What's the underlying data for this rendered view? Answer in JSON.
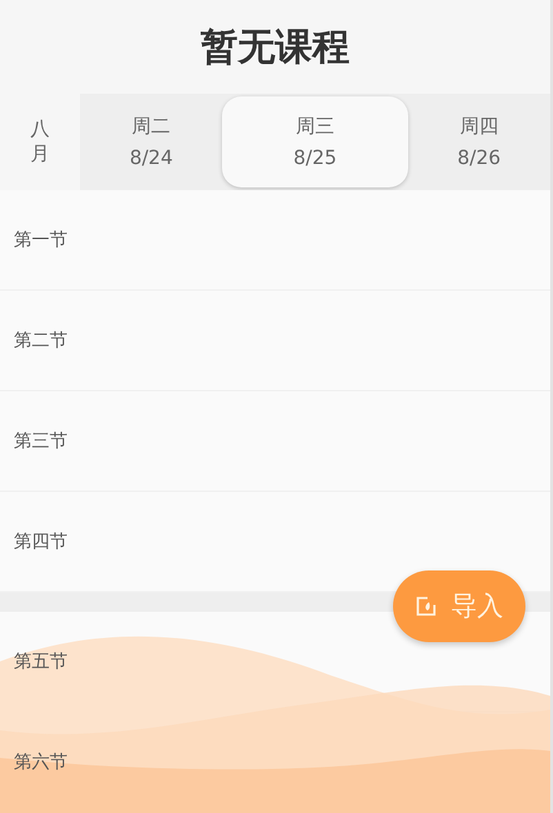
{
  "title": "暂无课程",
  "month": "八月",
  "days": [
    {
      "weekday": "周二",
      "date": "8/24",
      "selected": false
    },
    {
      "weekday": "周三",
      "date": "8/25",
      "selected": true
    },
    {
      "weekday": "周四",
      "date": "8/26",
      "selected": false
    }
  ],
  "periods": [
    {
      "label": "第一节",
      "break_before": false
    },
    {
      "label": "第二节",
      "break_before": false
    },
    {
      "label": "第三节",
      "break_before": false
    },
    {
      "label": "第四节",
      "break_before": false
    },
    {
      "label": "第五节",
      "break_before": true
    },
    {
      "label": "第六节",
      "break_before": false
    }
  ],
  "import_button": {
    "label": "导入"
  }
}
